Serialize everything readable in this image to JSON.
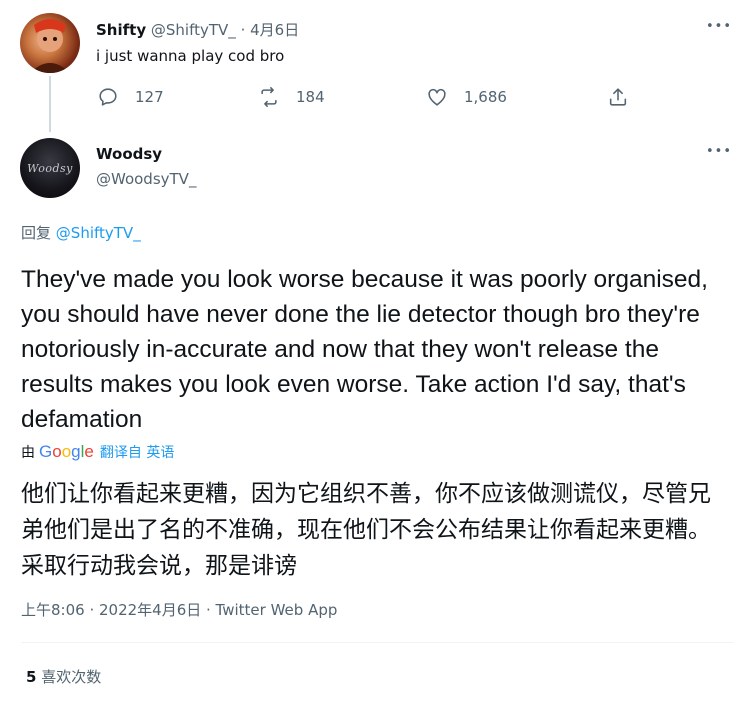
{
  "parent_tweet": {
    "display_name": "Shifty",
    "handle": "@ShiftyTV_",
    "separator": "·",
    "date": "4月6日",
    "text": "i just wanna play cod bro",
    "actions": {
      "reply_count": "127",
      "retweet_count": "184",
      "like_count": "1,686"
    }
  },
  "main_tweet": {
    "display_name": "Woodsy",
    "handle": "@WoodsyTV_",
    "avatar_text": "Woodsy",
    "reply_prefix": "回复",
    "reply_to": "@ShiftyTV_",
    "text": "They've made you look worse because it was poorly organised, you should have never done the lie detector though bro they're notoriously in-accurate and now that they won't release the results makes you look even worse. Take action I'd say, that's defamation",
    "translation_by": "由",
    "translation_action": "翻译自 英语",
    "translated_text": "他们让你看起来更糟，因为它组织不善，你不应该做测谎仪，尽管兄弟他们是出了名的不准确，现在他们不会公布结果让你看起来更糟。采取行动我会说，那是诽谤",
    "timestamp": "上午8:06 · 2022年4月6日 · Twitter Web App",
    "likes_count": "5",
    "likes_label": "喜欢次数"
  },
  "more_icon_glyph": "•••",
  "colors": {
    "accent": "#1d9bf0",
    "muted": "#536471",
    "text": "#0f1419",
    "divider": "#eff3f4"
  }
}
